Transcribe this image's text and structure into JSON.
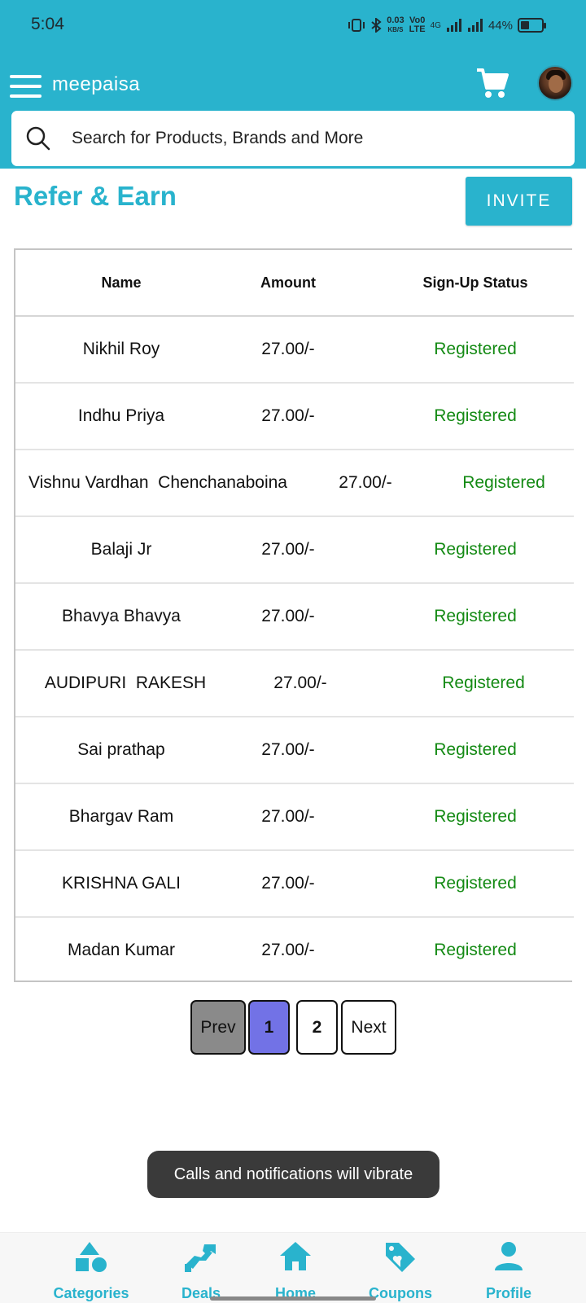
{
  "status_bar": {
    "time": "5:04",
    "net_speed_top": "0.03",
    "net_speed_bottom": "KB/S",
    "volte_top": "Vo0",
    "volte_bottom": "LTE",
    "net_type": "4G",
    "battery": "44%"
  },
  "header": {
    "brand": "meepaisa",
    "search_placeholder": "Search for Products, Brands and More"
  },
  "page": {
    "title": "Refer & Earn",
    "invite_label": "INVITE"
  },
  "table": {
    "headers": [
      "Name",
      "Amount",
      "Sign-Up Status"
    ],
    "rows": [
      {
        "name": "Nikhil Roy",
        "amount": "27.00/-",
        "status": "Registered"
      },
      {
        "name": "Indhu Priya",
        "amount": "27.00/-",
        "status": "Registered"
      },
      {
        "name": "Vishnu Vardhan  Chenchanaboina",
        "amount": "27.00/-",
        "status": "Registered"
      },
      {
        "name": "Balaji Jr",
        "amount": "27.00/-",
        "status": "Registered"
      },
      {
        "name": "Bhavya Bhavya",
        "amount": "27.00/-",
        "status": "Registered"
      },
      {
        "name": "AUDIPURI  RAKESH",
        "amount": "27.00/-",
        "status": "Registered"
      },
      {
        "name": "Sai prathap",
        "amount": "27.00/-",
        "status": "Registered"
      },
      {
        "name": "Bhargav Ram",
        "amount": "27.00/-",
        "status": "Registered"
      },
      {
        "name": "KRISHNA GALI",
        "amount": "27.00/-",
        "status": "Registered"
      },
      {
        "name": "Madan Kumar",
        "amount": "27.00/-",
        "status": "Registered"
      }
    ]
  },
  "pagination": {
    "prev": "Prev",
    "page1": "1",
    "page2": "2",
    "next": "Next"
  },
  "toast": "Calls and notifications will vibrate",
  "bottom_nav": {
    "categories": "Categories",
    "deals": "Deals",
    "home": "Home",
    "coupons": "Coupons",
    "profile": "Profile"
  },
  "colors": {
    "accent": "#29B3CD",
    "registered": "#148a14",
    "prev_bg": "#8a8a8a",
    "active_page_bg": "#7272e6",
    "toast_bg": "#3a3a3a"
  },
  "icons": [
    "menu-icon",
    "cart-icon",
    "avatar",
    "search-icon",
    "categories-icon",
    "deals-icon",
    "home-icon",
    "coupons-icon",
    "profile-icon"
  ]
}
